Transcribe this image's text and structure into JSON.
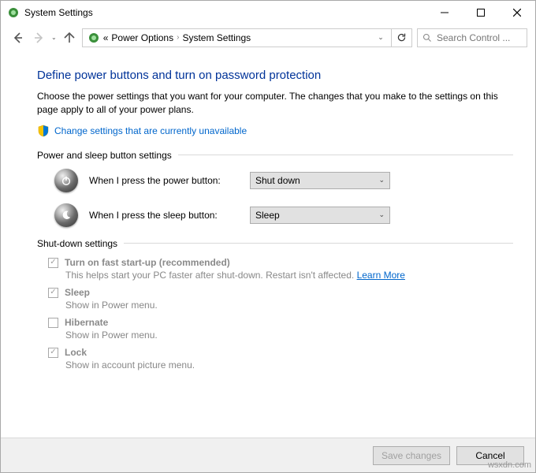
{
  "window": {
    "title": "System Settings"
  },
  "nav": {
    "breadcrumb": {
      "prefix": "«",
      "seg1": "Power Options",
      "seg2": "System Settings"
    }
  },
  "search": {
    "placeholder": "Search Control ..."
  },
  "page": {
    "heading": "Define power buttons and turn on password protection",
    "description": "Choose the power settings that you want for your computer. The changes that you make to the settings on this page apply to all of your power plans.",
    "change_link": "Change settings that are currently unavailable"
  },
  "power_section": {
    "title": "Power and sleep button settings",
    "rows": {
      "power": {
        "label": "When I press the power button:",
        "value": "Shut down"
      },
      "sleep": {
        "label": "When I press the sleep button:",
        "value": "Sleep"
      }
    }
  },
  "shutdown_section": {
    "title": "Shut-down settings",
    "fast": {
      "label": "Turn on fast start-up (recommended)",
      "sub": "This helps start your PC faster after shut-down. Restart isn't affected. ",
      "learn": "Learn More"
    },
    "sleep": {
      "label": "Sleep",
      "sub": "Show in Power menu."
    },
    "hiber": {
      "label": "Hibernate",
      "sub": "Show in Power menu."
    },
    "lock": {
      "label": "Lock",
      "sub": "Show in account picture menu."
    }
  },
  "footer": {
    "save": "Save changes",
    "cancel": "Cancel"
  },
  "watermark": "wsxdn.com"
}
